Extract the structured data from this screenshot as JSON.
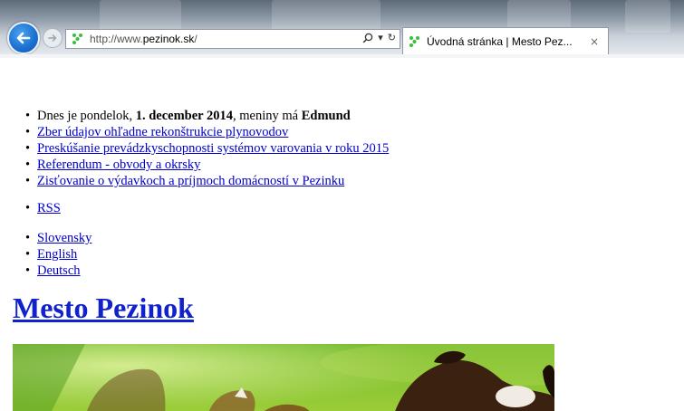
{
  "browser": {
    "url_prefix": "http://www.",
    "url_domain": "pezinok.sk",
    "url_suffix": "/",
    "tab_title": "Úvodná stránka | Mesto Pez...",
    "tab_close": "×",
    "search_glyph": "⌕",
    "dropdown_glyph": "▾",
    "refresh_glyph": "↻"
  },
  "page": {
    "date_line": {
      "prefix": "Dnes je pondelok, ",
      "date": "1. december 2014",
      "middle": ", meniny má ",
      "name": "Edmund"
    },
    "news": [
      "Zber údajov ohľadne rekonštrukcie plynovodov",
      "Preskúšanie prevádzkyschopnosti systémov varovania v roku 2015",
      "Referendum - obvody a okrsky",
      "Zisťovanie o výdavkoch a príjmoch domácností v Pezinku"
    ],
    "rss": "RSS",
    "languages": [
      "Slovensky",
      "English",
      "Deutsch"
    ],
    "site_title": "Mesto Pezinok"
  },
  "colors": {
    "link": "#1122cc",
    "back_button": "#1a6fcf",
    "favicon": "#3bbf3b"
  }
}
